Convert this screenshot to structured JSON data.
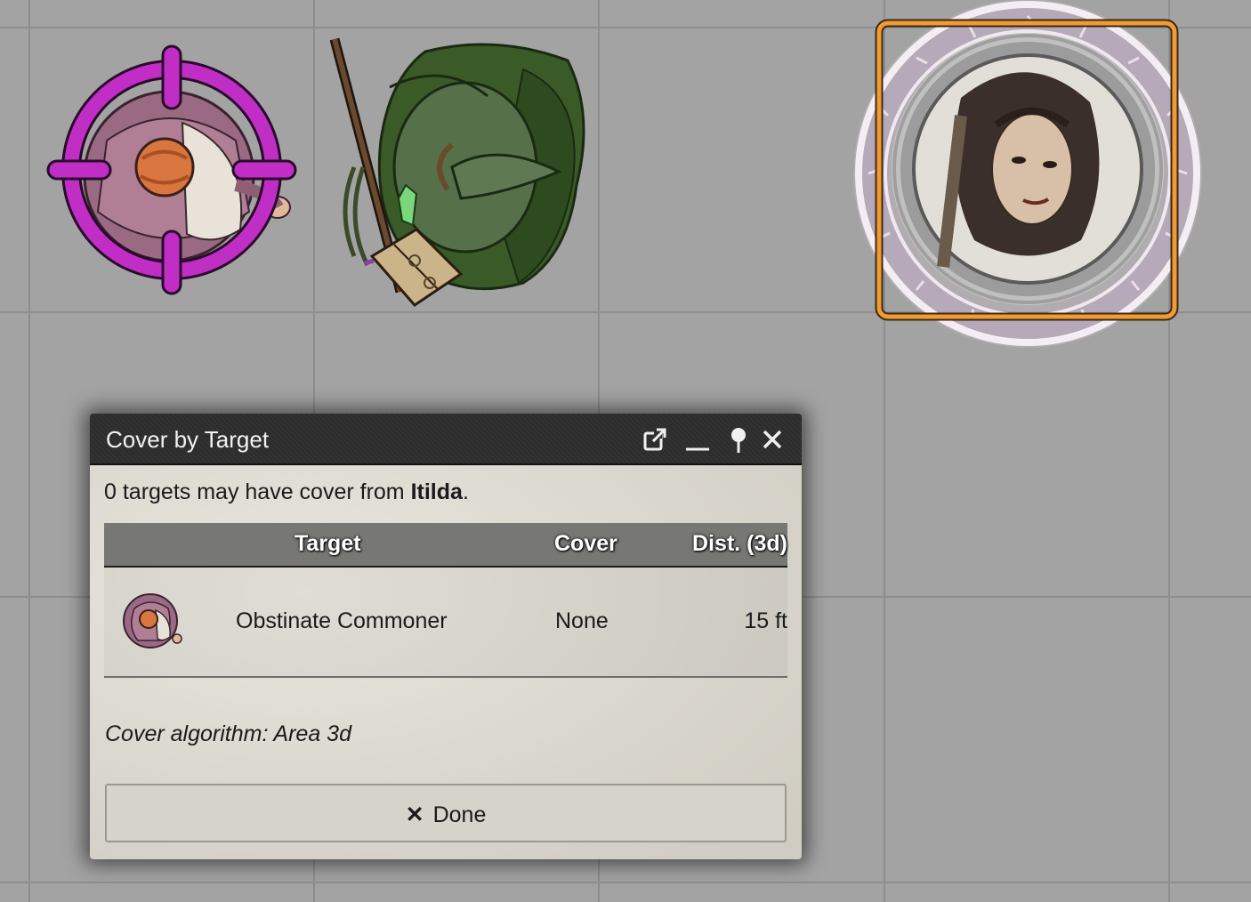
{
  "dialog": {
    "title": "Cover by Target",
    "summary_prefix": "0 targets may have cover from ",
    "summary_name": "Itilda",
    "summary_suffix": ".",
    "table": {
      "headers": [
        "Target",
        "Cover",
        "Dist. (3d)"
      ],
      "rows": [
        {
          "name": "Obstinate Commoner",
          "cover": "None",
          "distance": "15 ft"
        }
      ]
    },
    "algorithm": "Cover algorithm: Area 3d",
    "done_label": "Done",
    "done_icon": "✕"
  },
  "tokens": [
    {
      "name": "obstinate-commoner",
      "targeted": true,
      "target_color": "#c02ec6"
    },
    {
      "name": "green-hooded-caster",
      "targeted": false
    },
    {
      "name": "itilda",
      "selected": true,
      "selection_color": "#f29a35"
    }
  ],
  "colors": {
    "canvas": "#a3a3a3",
    "grid": "#8e8e8e",
    "header": "#2f2f2f"
  }
}
